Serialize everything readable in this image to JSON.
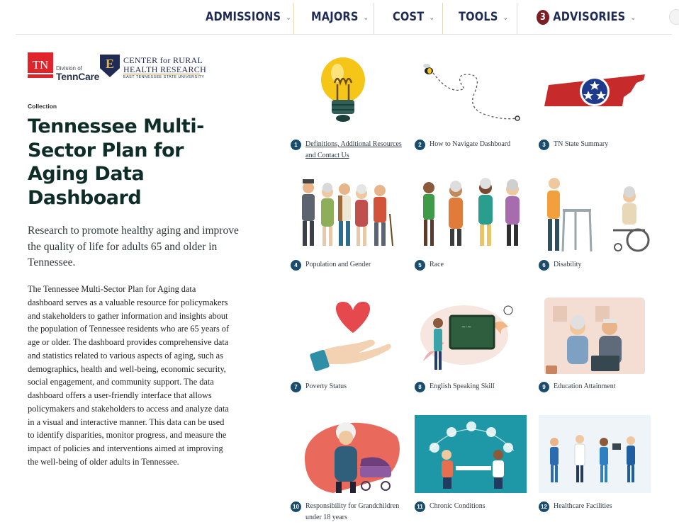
{
  "nav": {
    "items": [
      {
        "label": "ADMISSIONS"
      },
      {
        "label": "MAJORS"
      },
      {
        "label": "COST"
      },
      {
        "label": "TOOLS"
      },
      {
        "label": "ADVISORIES",
        "badge": "3"
      }
    ],
    "chevron": "⌄"
  },
  "logos": {
    "tn": "TN",
    "tenncare_division": "Division of",
    "tenncare_name": "TennCare",
    "etsu_letter": "E",
    "crhr_line1": "CENTER for RURAL",
    "crhr_line2": "HEALTH RESEARCH",
    "crhr_line3": "EAST TENNESSEE STATE UNIVERSITY"
  },
  "page": {
    "collection_label": "Collection",
    "title": "Tennessee Multi-Sector Plan for Aging Data Dashboard",
    "subtitle": "Research to promote healthy aging and improve the quality of life for adults 65 and older in Tennessee.",
    "body": "The Tennessee Multi-Sector Plan for Aging data dashboard serves as a valuable resource for policymakers and stakeholders to gather information and insights about the population of Tennessee residents who are 65 years of age or older. The dashboard provides comprehensive data and statistics related to various aspects of aging, such as demographics, health and well-being, economic security, social engagement, and community support. The data dashboard offers a user-friendly interface that allows policymakers and stakeholders to access and analyze data in a visual and interactive manner. This data can be used to identify disparities, monitor progress, and measure the impact of policies and interventions aimed at improving the well-being of older adults in Tennessee."
  },
  "tiles": [
    {
      "num": "1",
      "label": "Definitions, Additional Resources and Contact Us",
      "icon": "lightbulb-icon"
    },
    {
      "num": "2",
      "label": "How to Navigate Dashboard",
      "icon": "bee-path-icon"
    },
    {
      "num": "3",
      "label": "TN State Summary",
      "icon": "tennessee-map-icon"
    },
    {
      "num": "4",
      "label": "Population and Gender",
      "icon": "elderly-group-icon"
    },
    {
      "num": "5",
      "label": "Race",
      "icon": "diverse-elders-icon"
    },
    {
      "num": "6",
      "label": "Disability",
      "icon": "walker-wheelchair-icon"
    },
    {
      "num": "7",
      "label": "Poverty Status",
      "icon": "heart-hand-icon"
    },
    {
      "num": "8",
      "label": "English Speaking Skill",
      "icon": "chalkboard-teacher-icon"
    },
    {
      "num": "9",
      "label": "Education Attainment",
      "icon": "elderly-laptop-icon"
    },
    {
      "num": "10",
      "label": "Responsibility for Grandchildren under 18 years",
      "icon": "grandmother-stroller-icon"
    },
    {
      "num": "11",
      "label": "Chronic Conditions",
      "icon": "doctor-consult-icon"
    },
    {
      "num": "12",
      "label": "Healthcare Facilities",
      "icon": "medical-staff-icon"
    }
  ],
  "colors": {
    "nav_text": "#1f2a55",
    "badge": "#7d1e24",
    "tile_number": "#1a4d6d",
    "title": "#0f2d28",
    "tn_red": "#e0242b"
  }
}
